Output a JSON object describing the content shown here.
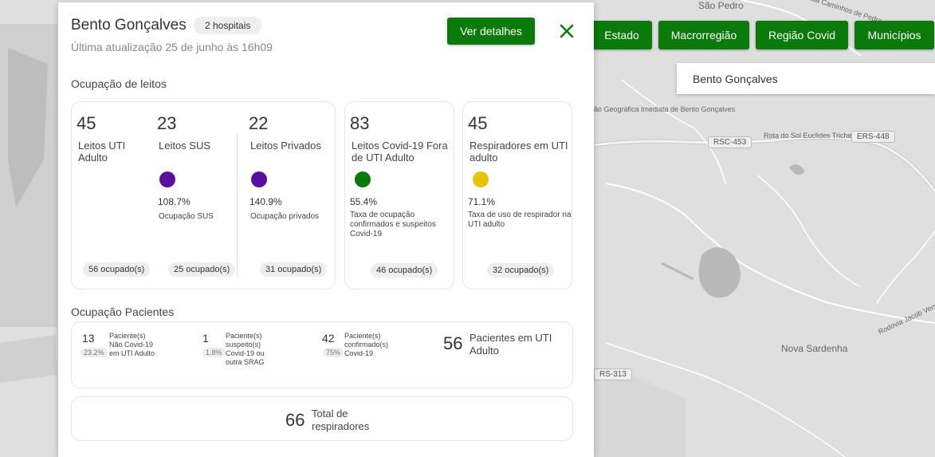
{
  "map": {
    "labels": {
      "sao_pedro": "São Pedro",
      "estrada": "Estrada Caminhos de Pedra",
      "regiao": "ão Geográfica Imediata de Bento Gonçalves",
      "rota": "Rota do Sol Euclides Triches",
      "rodovia": "Rodovia Jacob Versteg",
      "nova_sardenha": "Nova Sardenha"
    },
    "road_badges": {
      "rsc453": "RSC-453",
      "ers448": "ERS-448",
      "rs313": "RS-313"
    }
  },
  "level_buttons": [
    "Estado",
    "Macrorregião",
    "Região Covid",
    "Municípios"
  ],
  "search": {
    "value": "Bento Gonçalves"
  },
  "panel": {
    "title": "Bento Gonçalves",
    "hospitals_badge": "2 hospitais",
    "updated": "Última atualização 25 de junho às 16h09",
    "details_button": "Ver detalhes",
    "beds_section": "Ocupação de leitos",
    "patients_section": "Ocupação Pacientes",
    "beds": {
      "uti": {
        "value": "45",
        "label": "Leitos UTI Adulto",
        "occupied": "56 ocupado(s)"
      },
      "sus": {
        "value": "23",
        "label": "Leitos SUS",
        "pct": "108.7%",
        "pct_label": "Ocupação SUS",
        "occupied": "25 ocupado(s)"
      },
      "privados": {
        "value": "22",
        "label": "Leitos Privados",
        "pct": "140.9%",
        "pct_label": "Ocupação privados",
        "occupied": "31 ocupado(s)"
      },
      "covid": {
        "value": "83",
        "label": "Leitos Covid-19 Fora de UTI Adulto",
        "pct": "55.4%",
        "pct_label": "Taxa de ocupação confirmados e suspeitos Covid-19",
        "occupied": "46 ocupado(s)"
      },
      "respiradores": {
        "value": "45",
        "label": "Respiradores em UTI adulto",
        "pct": "71.1%",
        "pct_label": "Taxa de uso de respirador na UTI adulto",
        "occupied": "32 ocupado(s)"
      }
    },
    "patients": {
      "nao_covid": {
        "value": "13",
        "pct": "23.2%",
        "label": "Paciente(s) Não Covid-19 em UTI Adulto"
      },
      "suspeito": {
        "value": "1",
        "pct": "1.8%",
        "label": "Paciente(s) suspeito(s) Covid-19 ou outra SRAG"
      },
      "confirmado": {
        "value": "42",
        "pct": "75%",
        "label": "Paciente(s) confirmado(s) Covid-19"
      },
      "uti": {
        "value": "56",
        "label": "Pacientes em UTI Adulto"
      }
    },
    "respiradores_total": {
      "value": "66",
      "label": "Total de respiradores"
    }
  },
  "colors": {
    "primary_green": "#0a7a0a",
    "purple": "#5b0f9e",
    "green_dot": "#0a7a0a",
    "yellow_dot": "#e8c30a"
  }
}
